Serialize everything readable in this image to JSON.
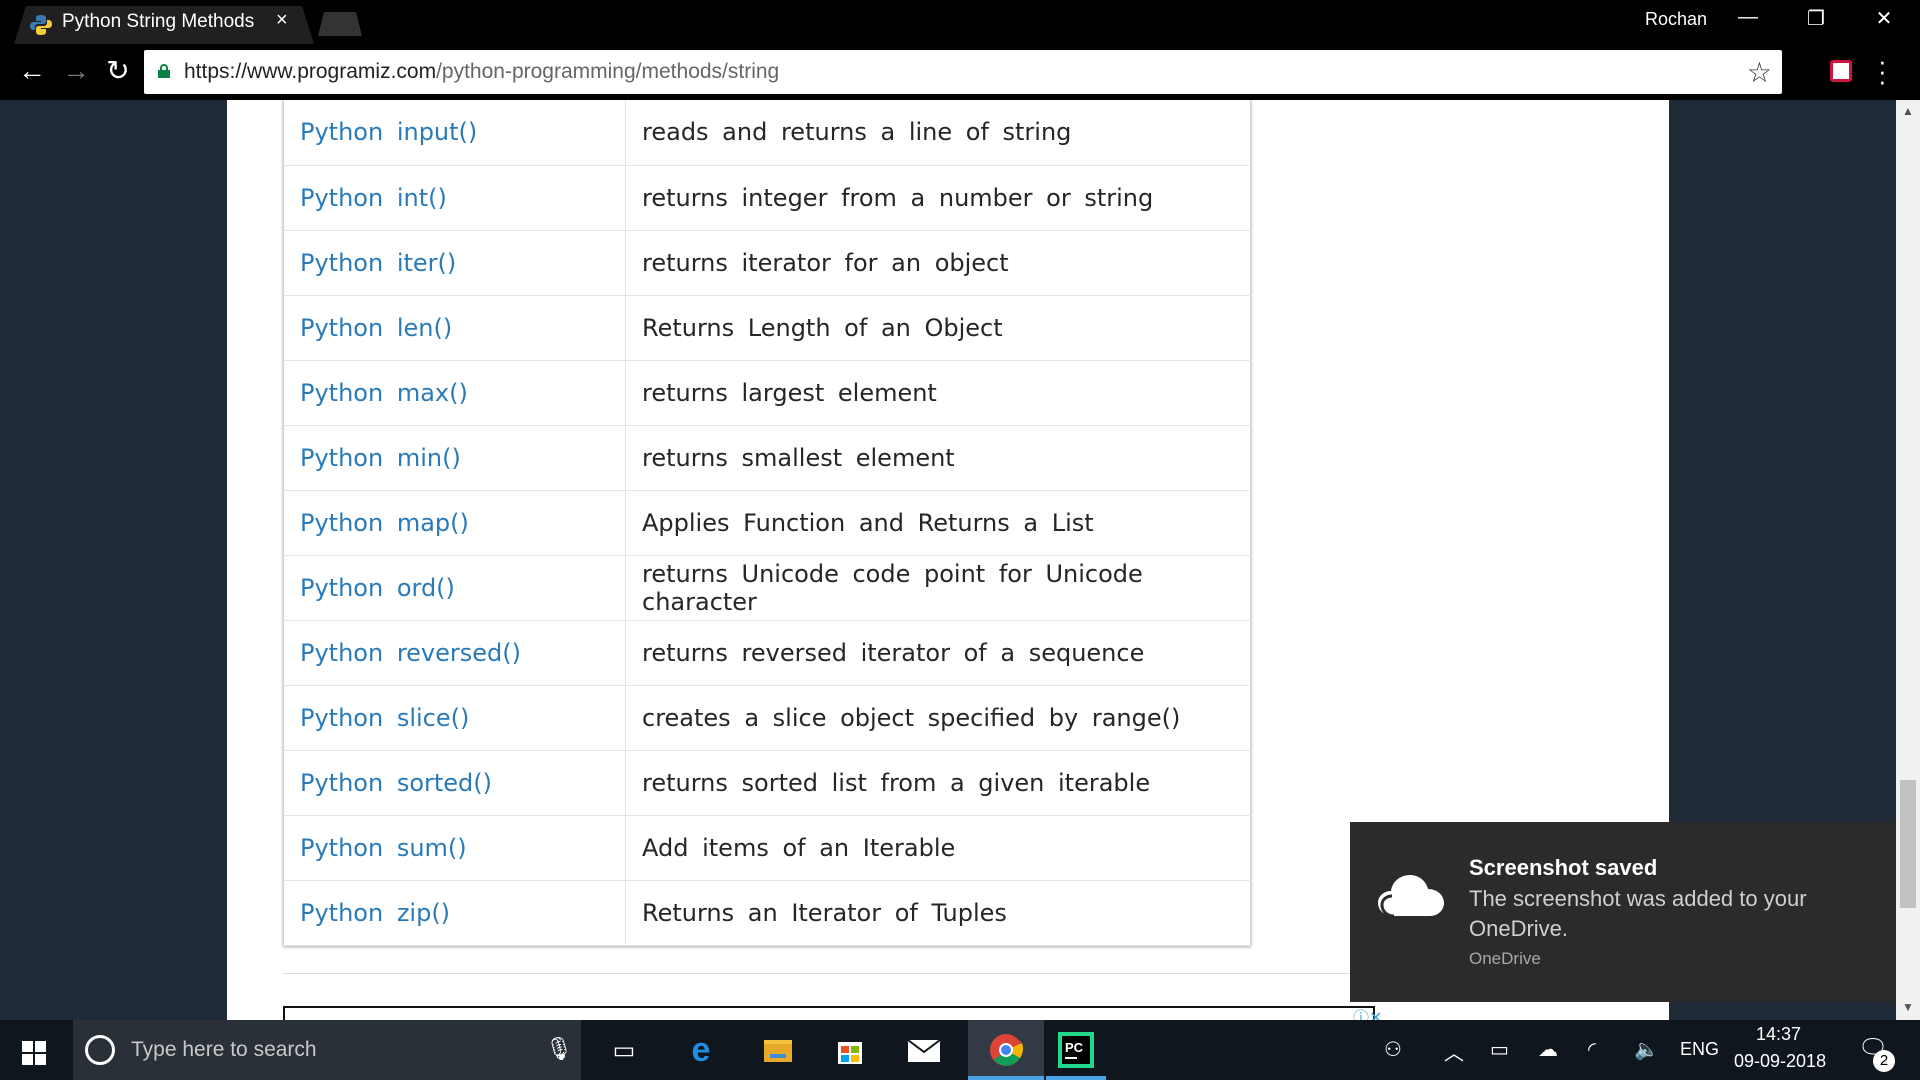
{
  "browser": {
    "tab_title": "Python String Methods",
    "tab_close": "×",
    "profile_name": "Rochan",
    "url_scheme_host": "https://www.programiz.com",
    "url_path": "/python-programming/methods/string",
    "icons": [
      "python-favicon",
      "back-arrow",
      "forward-arrow",
      "reload",
      "lock",
      "star",
      "pocket",
      "menu-dots"
    ]
  },
  "window_controls": {
    "minimize": "—",
    "restore": "❐",
    "close": "✕"
  },
  "nav": {
    "back": "←",
    "forward": "→",
    "reload": "↻",
    "star": "☆"
  },
  "table": {
    "rows": [
      {
        "name": "Python input()",
        "desc": "reads and returns a line of string"
      },
      {
        "name": "Python int()",
        "desc": "returns integer from a number or string"
      },
      {
        "name": "Python iter()",
        "desc": "returns iterator for an object"
      },
      {
        "name": "Python len()",
        "desc": "Returns Length of an Object"
      },
      {
        "name": "Python max()",
        "desc": "returns largest element"
      },
      {
        "name": "Python min()",
        "desc": "returns smallest element"
      },
      {
        "name": "Python map()",
        "desc": "Applies Function and Returns a List"
      },
      {
        "name": "Python ord()",
        "desc": "returns Unicode code point for Unicode character"
      },
      {
        "name": "Python reversed()",
        "desc": "returns reversed iterator of a sequence"
      },
      {
        "name": "Python slice()",
        "desc": "creates a slice object specified by range()"
      },
      {
        "name": "Python sorted()",
        "desc": "returns sorted list from a given iterable"
      },
      {
        "name": "Python sum()",
        "desc": "Add items of an Iterable"
      },
      {
        "name": "Python zip()",
        "desc": "Returns an Iterator of Tuples"
      }
    ],
    "link_color": "#2a7ab9"
  },
  "toast": {
    "title": "Screenshot saved",
    "body": "The screenshot was added to your OneDrive.",
    "source": "OneDrive"
  },
  "taskbar": {
    "search_placeholder": "Type here to search",
    "language": "ENG",
    "time": "14:37",
    "date": "09-09-2018",
    "notification_count": "2",
    "apps": [
      "task-view",
      "edge",
      "file-explorer",
      "store",
      "mail",
      "chrome",
      "pycharm"
    ]
  }
}
